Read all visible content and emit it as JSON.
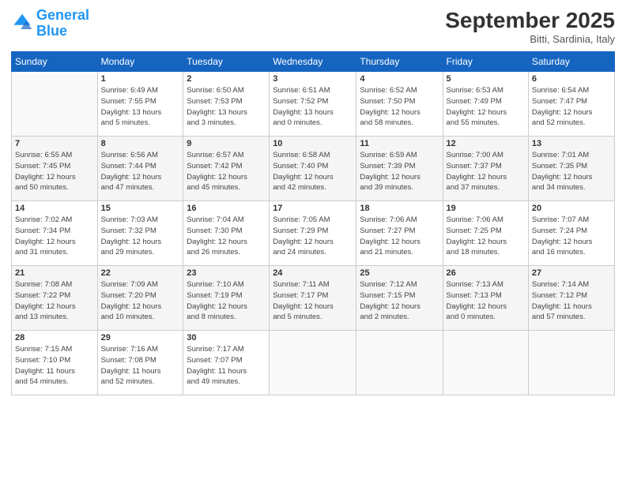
{
  "logo": {
    "line1": "General",
    "line2": "Blue"
  },
  "title": "September 2025",
  "subtitle": "Bitti, Sardinia, Italy",
  "days_header": [
    "Sunday",
    "Monday",
    "Tuesday",
    "Wednesday",
    "Thursday",
    "Friday",
    "Saturday"
  ],
  "weeks": [
    [
      {
        "day": "",
        "info": ""
      },
      {
        "day": "1",
        "info": "Sunrise: 6:49 AM\nSunset: 7:55 PM\nDaylight: 13 hours\nand 5 minutes."
      },
      {
        "day": "2",
        "info": "Sunrise: 6:50 AM\nSunset: 7:53 PM\nDaylight: 13 hours\nand 3 minutes."
      },
      {
        "day": "3",
        "info": "Sunrise: 6:51 AM\nSunset: 7:52 PM\nDaylight: 13 hours\nand 0 minutes."
      },
      {
        "day": "4",
        "info": "Sunrise: 6:52 AM\nSunset: 7:50 PM\nDaylight: 12 hours\nand 58 minutes."
      },
      {
        "day": "5",
        "info": "Sunrise: 6:53 AM\nSunset: 7:49 PM\nDaylight: 12 hours\nand 55 minutes."
      },
      {
        "day": "6",
        "info": "Sunrise: 6:54 AM\nSunset: 7:47 PM\nDaylight: 12 hours\nand 52 minutes."
      }
    ],
    [
      {
        "day": "7",
        "info": "Sunrise: 6:55 AM\nSunset: 7:45 PM\nDaylight: 12 hours\nand 50 minutes."
      },
      {
        "day": "8",
        "info": "Sunrise: 6:56 AM\nSunset: 7:44 PM\nDaylight: 12 hours\nand 47 minutes."
      },
      {
        "day": "9",
        "info": "Sunrise: 6:57 AM\nSunset: 7:42 PM\nDaylight: 12 hours\nand 45 minutes."
      },
      {
        "day": "10",
        "info": "Sunrise: 6:58 AM\nSunset: 7:40 PM\nDaylight: 12 hours\nand 42 minutes."
      },
      {
        "day": "11",
        "info": "Sunrise: 6:59 AM\nSunset: 7:39 PM\nDaylight: 12 hours\nand 39 minutes."
      },
      {
        "day": "12",
        "info": "Sunrise: 7:00 AM\nSunset: 7:37 PM\nDaylight: 12 hours\nand 37 minutes."
      },
      {
        "day": "13",
        "info": "Sunrise: 7:01 AM\nSunset: 7:35 PM\nDaylight: 12 hours\nand 34 minutes."
      }
    ],
    [
      {
        "day": "14",
        "info": "Sunrise: 7:02 AM\nSunset: 7:34 PM\nDaylight: 12 hours\nand 31 minutes."
      },
      {
        "day": "15",
        "info": "Sunrise: 7:03 AM\nSunset: 7:32 PM\nDaylight: 12 hours\nand 29 minutes."
      },
      {
        "day": "16",
        "info": "Sunrise: 7:04 AM\nSunset: 7:30 PM\nDaylight: 12 hours\nand 26 minutes."
      },
      {
        "day": "17",
        "info": "Sunrise: 7:05 AM\nSunset: 7:29 PM\nDaylight: 12 hours\nand 24 minutes."
      },
      {
        "day": "18",
        "info": "Sunrise: 7:06 AM\nSunset: 7:27 PM\nDaylight: 12 hours\nand 21 minutes."
      },
      {
        "day": "19",
        "info": "Sunrise: 7:06 AM\nSunset: 7:25 PM\nDaylight: 12 hours\nand 18 minutes."
      },
      {
        "day": "20",
        "info": "Sunrise: 7:07 AM\nSunset: 7:24 PM\nDaylight: 12 hours\nand 16 minutes."
      }
    ],
    [
      {
        "day": "21",
        "info": "Sunrise: 7:08 AM\nSunset: 7:22 PM\nDaylight: 12 hours\nand 13 minutes."
      },
      {
        "day": "22",
        "info": "Sunrise: 7:09 AM\nSunset: 7:20 PM\nDaylight: 12 hours\nand 10 minutes."
      },
      {
        "day": "23",
        "info": "Sunrise: 7:10 AM\nSunset: 7:19 PM\nDaylight: 12 hours\nand 8 minutes."
      },
      {
        "day": "24",
        "info": "Sunrise: 7:11 AM\nSunset: 7:17 PM\nDaylight: 12 hours\nand 5 minutes."
      },
      {
        "day": "25",
        "info": "Sunrise: 7:12 AM\nSunset: 7:15 PM\nDaylight: 12 hours\nand 2 minutes."
      },
      {
        "day": "26",
        "info": "Sunrise: 7:13 AM\nSunset: 7:13 PM\nDaylight: 12 hours\nand 0 minutes."
      },
      {
        "day": "27",
        "info": "Sunrise: 7:14 AM\nSunset: 7:12 PM\nDaylight: 11 hours\nand 57 minutes."
      }
    ],
    [
      {
        "day": "28",
        "info": "Sunrise: 7:15 AM\nSunset: 7:10 PM\nDaylight: 11 hours\nand 54 minutes."
      },
      {
        "day": "29",
        "info": "Sunrise: 7:16 AM\nSunset: 7:08 PM\nDaylight: 11 hours\nand 52 minutes."
      },
      {
        "day": "30",
        "info": "Sunrise: 7:17 AM\nSunset: 7:07 PM\nDaylight: 11 hours\nand 49 minutes."
      },
      {
        "day": "",
        "info": ""
      },
      {
        "day": "",
        "info": ""
      },
      {
        "day": "",
        "info": ""
      },
      {
        "day": "",
        "info": ""
      }
    ]
  ]
}
